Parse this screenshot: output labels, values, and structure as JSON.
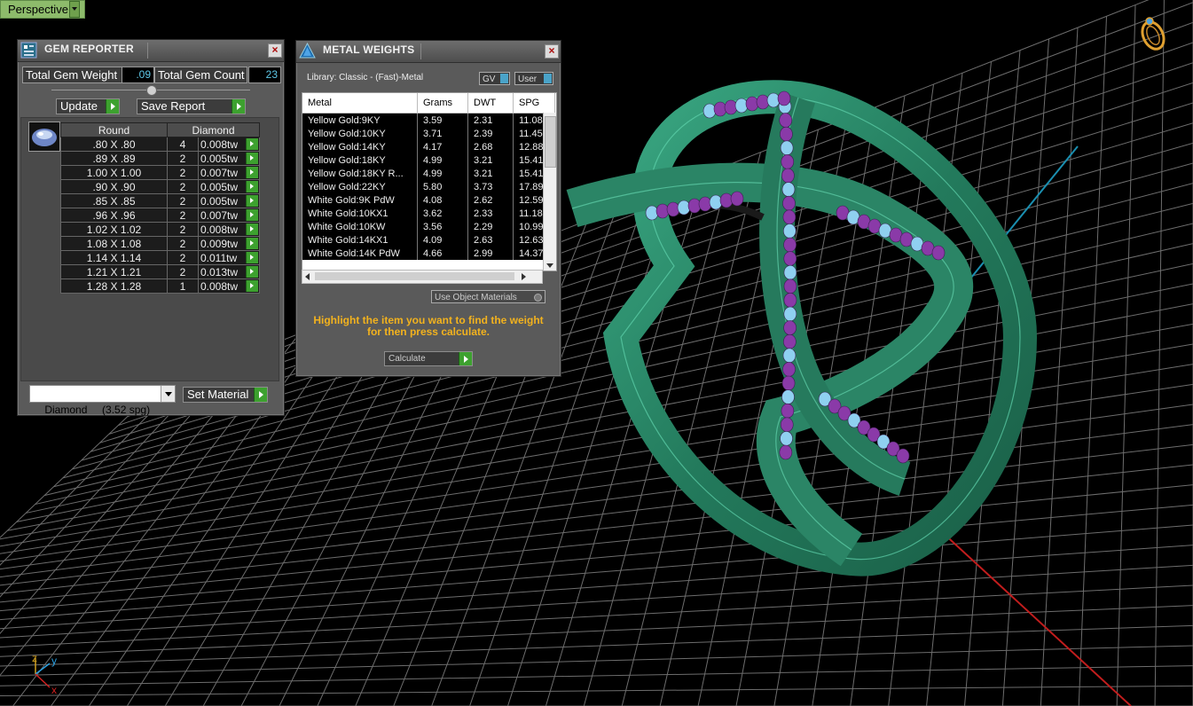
{
  "viewport": {
    "mode_label": "Perspective",
    "axis_labels": {
      "x": "x",
      "y": "y",
      "z": "z"
    }
  },
  "gem_reporter": {
    "title": "GEM REPORTER",
    "total_gem_weight_label": "Total Gem Weight",
    "total_gem_weight": ".09",
    "total_gem_count_label": "Total Gem Count",
    "total_gem_count": "23",
    "update_label": "Update",
    "save_report_label": "Save Report",
    "table": {
      "headers": [
        "Round",
        "Diamond"
      ],
      "rows": [
        {
          "size": ".80 X .80",
          "count": "4",
          "weight": "0.008tw"
        },
        {
          "size": ".89 X .89",
          "count": "2",
          "weight": "0.005tw"
        },
        {
          "size": "1.00 X 1.00",
          "count": "2",
          "weight": "0.007tw"
        },
        {
          "size": ".90 X .90",
          "count": "2",
          "weight": "0.005tw"
        },
        {
          "size": ".85 X .85",
          "count": "2",
          "weight": "0.005tw"
        },
        {
          "size": ".96 X .96",
          "count": "2",
          "weight": "0.007tw"
        },
        {
          "size": "1.02 X 1.02",
          "count": "2",
          "weight": "0.008tw"
        },
        {
          "size": "1.08 X 1.08",
          "count": "2",
          "weight": "0.009tw"
        },
        {
          "size": "1.14 X 1.14",
          "count": "2",
          "weight": "0.011tw"
        },
        {
          "size": "1.21 X 1.21",
          "count": "2",
          "weight": "0.013tw"
        },
        {
          "size": "1.28 X 1.28",
          "count": "1",
          "weight": "0.008tw"
        }
      ]
    },
    "material_select": "Diamond     (3.52 spg)",
    "set_material_label": "Set Material"
  },
  "metal_weights": {
    "title": "METAL WEIGHTS",
    "library_label": "Library: Classic - (Fast)-Metal",
    "gv_label": "GV",
    "user_label": "User",
    "headers": [
      "Metal",
      "Grams",
      "DWT",
      "SPG"
    ],
    "rows": [
      [
        "Yellow Gold:9KY",
        "3.59",
        "2.31",
        "11.08"
      ],
      [
        "Yellow Gold:10KY",
        "3.71",
        "2.39",
        "11.45"
      ],
      [
        "Yellow Gold:14KY",
        "4.17",
        "2.68",
        "12.88"
      ],
      [
        "Yellow Gold:18KY",
        "4.99",
        "3.21",
        "15.41"
      ],
      [
        "Yellow Gold:18KY R...",
        "4.99",
        "3.21",
        "15.41"
      ],
      [
        "Yellow Gold:22KY",
        "5.80",
        "3.73",
        "17.89"
      ],
      [
        "White Gold:9K PdW",
        "4.08",
        "2.62",
        "12.59"
      ],
      [
        "White Gold:10KX1",
        "3.62",
        "2.33",
        "11.18"
      ],
      [
        "White Gold:10KW",
        "3.56",
        "2.29",
        "10.99"
      ],
      [
        "White Gold:14KX1",
        "4.09",
        "2.63",
        "12.63"
      ],
      [
        "White Gold:14K PdW",
        "4.66",
        "2.99",
        "14.37"
      ]
    ],
    "use_object_materials_label": "Use Object Materials",
    "hint": "Highlight the item you want to find the weight for then press calculate.",
    "calculate_label": "Calculate"
  },
  "colors": {
    "ring": "#2e8a6a",
    "gem_purple": "#8a3aa8",
    "gem_blue": "#8fd0f0",
    "hint_text": "#f2b21e"
  }
}
